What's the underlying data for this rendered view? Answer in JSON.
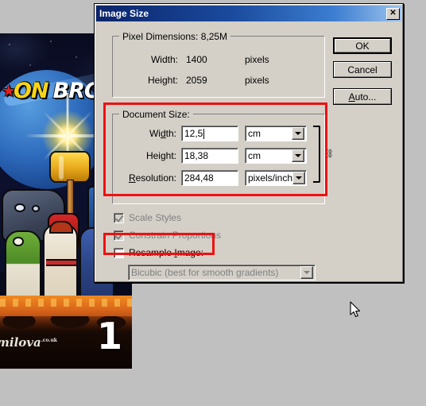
{
  "window": {
    "title": "Image Size",
    "close_icon": "close-icon",
    "close_label": "✕"
  },
  "pixel_dimensions": {
    "legend": "Pixel Dimensions:  8,25M",
    "size_value": "8,25M",
    "rows": [
      {
        "label": "Width:",
        "value": "1400",
        "unit": "pixels"
      },
      {
        "label": "Height:",
        "value": "2059",
        "unit": "pixels"
      }
    ]
  },
  "document_size": {
    "legend": "Document Size:",
    "width": {
      "label": "Width:",
      "label_accel": "d",
      "value": "12,5",
      "unit": "cm",
      "focused": true
    },
    "height": {
      "label": "Height:",
      "value": "18,38",
      "unit": "cm"
    },
    "resolution": {
      "label": "Resolution:",
      "label_accel": "R",
      "value": "284,48",
      "unit": "pixels/inch"
    },
    "link_icon": "chain-link-icon",
    "link_glyph": "⛓"
  },
  "options": {
    "scale_styles": {
      "label": "Scale Styles",
      "checked": true,
      "enabled": false
    },
    "constrain_proportions": {
      "label": "Constrain Proportions",
      "checked": true,
      "enabled": false
    },
    "resample_image": {
      "label": "Resample Image:",
      "checked": false,
      "enabled": true
    },
    "resample_method": {
      "value": "Bicubic (best for smooth gradients)",
      "enabled": false
    }
  },
  "buttons": {
    "ok": "OK",
    "cancel": "Cancel",
    "auto": "Auto..."
  },
  "annotations": {
    "document_size_box": "red-highlight-document-size",
    "resample_box": "red-highlight-resample-image",
    "color": "#ee1111"
  },
  "artwork": {
    "title_part1": "ON",
    "title_part2": "BROS.",
    "issue_number": "1",
    "signature": "milova",
    "signature_tld": ".co.uk"
  },
  "cursor": {
    "icon": "mouse-pointer-icon"
  }
}
